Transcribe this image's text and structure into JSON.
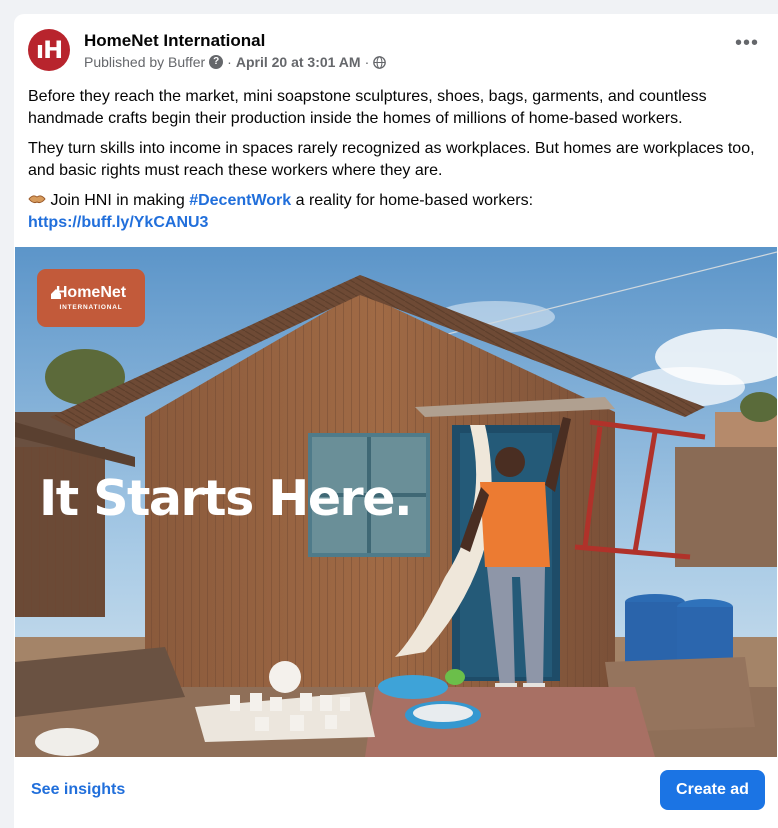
{
  "post": {
    "page_name": "HomeNet International",
    "avatar_text": "ıH",
    "published_by": "Published by Buffer",
    "date": "April 20 at 3:01 AM",
    "separator": "·",
    "more_label": "•••",
    "paragraph1": "Before they reach the market, mini soapstone sculptures, shoes, bags, garments, and countless handmade crafts begin their production inside the homes of millions of home-based workers.",
    "paragraph2": "They turn skills into income in spaces rarely recognized as workplaces. But homes are workplaces too, and basic rights must reach these workers where they are.",
    "paragraph3_prefix": "Join HNI in making",
    "hashtag": "#DecentWork",
    "paragraph3_suffix": "a reality for home-based workers:",
    "link": "https://buff.ly/YkCANU3"
  },
  "media": {
    "logo_line1": "HomeNet",
    "logo_line2": "INTERNATIONAL",
    "headline": "It Starts Here."
  },
  "footer": {
    "insights_label": "See insights",
    "create_ad_label": "Create ad"
  },
  "colors": {
    "brand": "#b8242d",
    "link": "#216fdb",
    "button": "#1b74e4",
    "logo_bg": "#c25a3a"
  },
  "icons": {
    "help": "question-circle-icon",
    "audience": "globe-icon",
    "emoji": "handshake-emoji-icon"
  }
}
